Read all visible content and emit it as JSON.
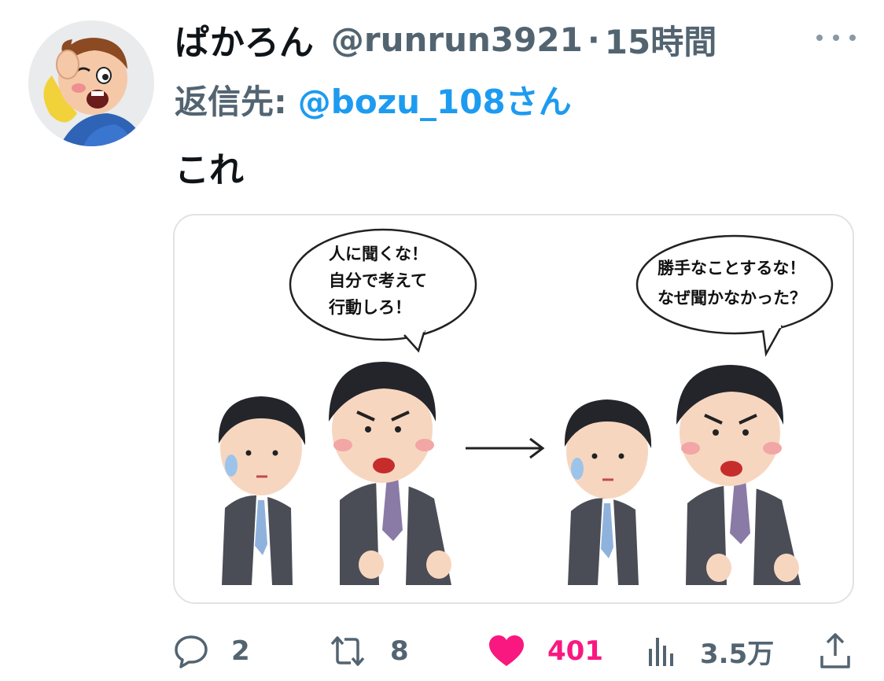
{
  "tweet": {
    "display_name": "ぱかろん",
    "handle": "@runrun3921",
    "separator": "·",
    "time": "15時間",
    "reply_prefix": "返信先:",
    "reply_target": "@bozu_108さん",
    "text": "これ",
    "image": {
      "left_bubble": [
        "人に聞くな！",
        "自分で考えて",
        "行動しろ！"
      ],
      "right_bubble": [
        "勝手なことするな！",
        "なぜ聞かなかった？"
      ]
    }
  },
  "actions": {
    "reply_count": "2",
    "retweet_count": "8",
    "like_count": "401",
    "views_count": "3.5万"
  },
  "colors": {
    "like_pink": "#f91880",
    "link_blue": "#1d9bf0",
    "muted_gray": "#536471"
  },
  "icons": [
    "more-icon",
    "reply-icon",
    "retweet-icon",
    "heart-icon",
    "views-icon",
    "share-icon"
  ]
}
